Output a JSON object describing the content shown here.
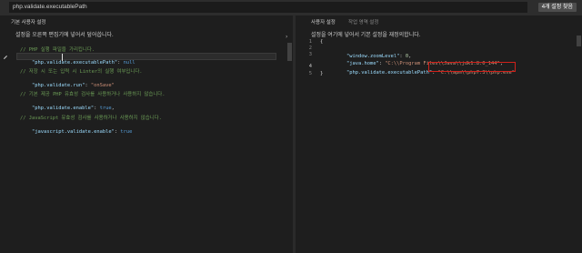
{
  "search": {
    "value": "php.validate.executablePath",
    "count_badge": "4개 설정 찾음"
  },
  "left": {
    "tab_label": "기본 사용자 설정",
    "description": "설정을 오른쪽 편집기에 넣어서 덮어씁니다.",
    "collapse_glyph": "›",
    "settings": [
      {
        "comment": "// PHP 실행 파일을 가리킵니다.",
        "key_pre": "\"php.validate.exe",
        "key_post": "cutablePath\"",
        "sep": ": ",
        "value": "null",
        "value_type": "kw"
      },
      {
        "comment": "// 저장 시 또는 입력 시 Linter의 실행 여부입니다.",
        "key": "\"php.validate.run\"",
        "sep": ": ",
        "value": "\"onSave\"",
        "value_type": "str"
      },
      {
        "comment": "// 기본 제공 PHP 유효성 검사를 사용하거나 사용하지 않습니다.",
        "key": "\"php.validate.enable\"",
        "sep": ": ",
        "value": "true",
        "value_type": "kw",
        "tail": ","
      },
      {
        "comment": "// JavaScript 유효성 검사를 사용하거나 사용하지 않습니다.",
        "key": "\"javascript.validate.enable\"",
        "sep": ": ",
        "value": "true",
        "value_type": "kw"
      }
    ]
  },
  "right": {
    "tab_user": "사용자 설정",
    "tab_workspace": "작업 영역 설정",
    "description": "설정을 여기에 넣어서 기본 설정을 재정의합니다.",
    "line_numbers": [
      "1",
      "2",
      "3",
      "4",
      "5"
    ],
    "open_brace": "{",
    "close_brace": "}",
    "lines": [
      {
        "key": "\"window.zoomLevel\"",
        "sep": ": ",
        "value": "0",
        "value_type": "num",
        "tail": ","
      },
      {
        "key": "\"java.home\"",
        "sep": ": ",
        "value": "\"C:\\\\Program Files\\\\Java\\\\jdk1.8.0_144\"",
        "value_type": "str",
        "tail": ","
      },
      {
        "key": "\"php.validate.executablePath\"",
        "sep": ": ",
        "value": "\"C:\\\\apm\\\\php7.3\\\\php.exe\"",
        "value_type": "str",
        "tail": ""
      }
    ]
  },
  "colors": {
    "highlight_box": "#d0211b",
    "comment": "#6a9955",
    "key": "#9cdcfe",
    "string": "#ce9178",
    "keyword": "#569cd6"
  }
}
